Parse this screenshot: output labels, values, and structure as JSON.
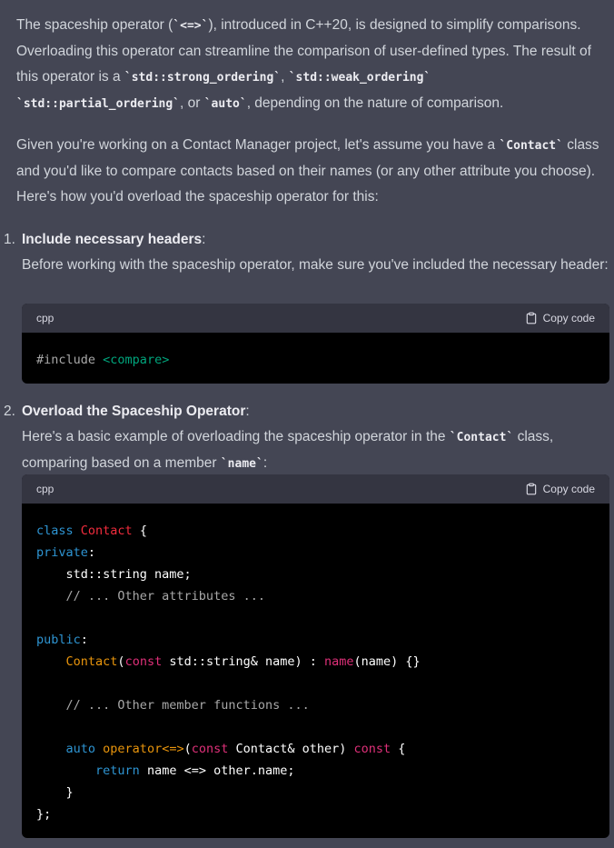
{
  "intro": {
    "t1": "The spaceship operator (",
    "c1": "`<=>`",
    "t2": "), introduced in C++20, is designed to simplify comparisons. Overloading this operator can streamline the comparison of user-defined types. The result of this operator is a ",
    "c2": "`std::strong_ordering`",
    "t3": ", ",
    "c3": "`std::weak_ordering`",
    "t4": ", ",
    "c4": "`std::partial_ordering`",
    "t5": ", or ",
    "c5": "`auto`",
    "t6": ", depending on the nature of comparison."
  },
  "para2": {
    "t1": "Given you're working on a Contact Manager project, let's assume you have a ",
    "c1": "`Contact`",
    "t2": " class and you'd like to compare contacts based on their names (or any other attribute you choose). Here's how you'd overload the spaceship operator for this:"
  },
  "steps": [
    {
      "number": "1.",
      "title": "Include necessary headers",
      "colon": ":",
      "body": "Before working with the spaceship operator, make sure you've included the necessary header:"
    },
    {
      "number": "2.",
      "title": "Overload the Spaceship Operator",
      "colon": ":",
      "b1": "Here's a basic example of overloading the spaceship operator in the ",
      "c1": "`Contact`",
      "b2": " class, comparing based on a member ",
      "c2": "`name`",
      "b3": ":"
    }
  ],
  "code_blocks": [
    {
      "language": "cpp",
      "copy_label": "Copy code",
      "code": {
        "l1_directive": "#include",
        "l1_space": " ",
        "l1_header": "<compare>"
      }
    },
    {
      "language": "cpp",
      "copy_label": "Copy code",
      "code": {
        "kw_class": "class",
        "cls_name": "Contact",
        "brace_open": " {",
        "kw_private": "private",
        "l_member": "    std::string name;",
        "l_cm1": "    // ... Other attributes ...",
        "kw_public": "public",
        "ctor_name": "Contact",
        "ctor_paren": "(",
        "kw_const1": "const",
        "ctor_args": " std::string& name) : ",
        "init_name": "name",
        "init_rest": "(name) {}",
        "l_cm2": "    // ... Other member functions ...",
        "kw_auto": "auto",
        "op_name": "operator<=>",
        "op_paren": "(",
        "kw_const2": "const",
        "op_args": " Contact& other) ",
        "kw_const3": "const",
        "op_brace": " {",
        "kw_return": "return",
        "ret_expr": " name <=> other.name;",
        "close_inner": "    }",
        "close_class": "};"
      }
    }
  ],
  "colors": {
    "background": "#444654",
    "code_background": "#000000",
    "code_header": "#343541",
    "keyword": "#2e95d3",
    "class_name": "#f22c3d",
    "string": "#00a67d",
    "function": "#df3079",
    "comment": "#a8a8a8"
  },
  "icons": {
    "copy": "clipboard-icon"
  }
}
